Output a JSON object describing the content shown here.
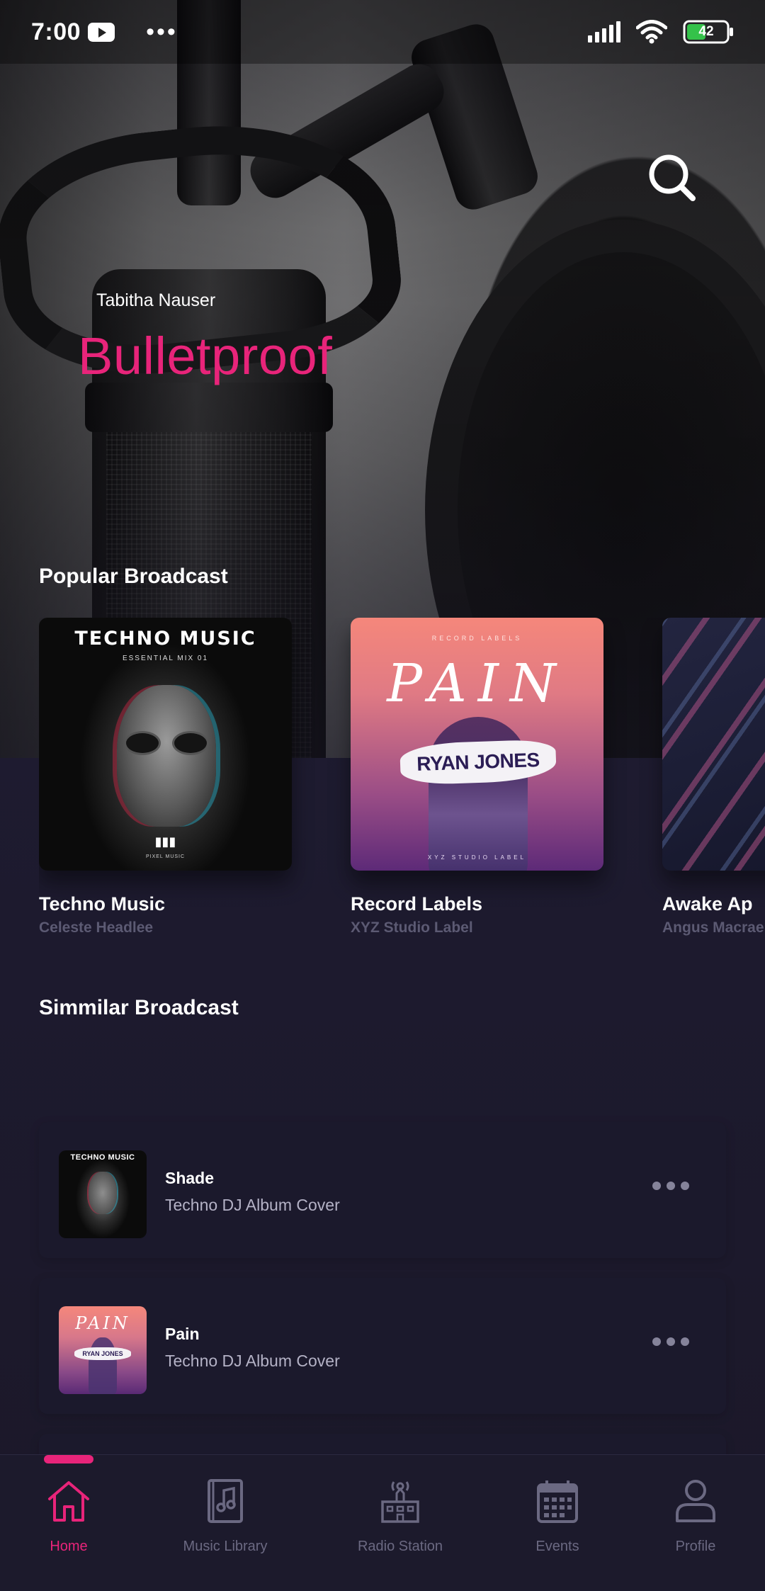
{
  "status_bar": {
    "time": "7:00",
    "more": "•••",
    "battery": "42"
  },
  "hero": {
    "artist": "Tabitha Nauser",
    "title": "Bulletproof",
    "accent_color": "#e8247a"
  },
  "popular": {
    "heading": "Popular Broadcast",
    "cards": [
      {
        "title": "Techno Music",
        "subtitle": "Celeste Headlee",
        "cover": {
          "title": "TECHNO MUSIC",
          "subtitle": "ESSENTIAL MIX 01",
          "logo": "PIXEL MUSIC"
        }
      },
      {
        "title": "Record Labels",
        "subtitle": "XYZ Studio Label",
        "cover": {
          "label": "RECORD LABELS",
          "script": "PAIN",
          "name": "RYAN JONES",
          "footer": "XYZ STUDIO LABEL"
        }
      },
      {
        "title": "Awake Ap",
        "subtitle": "Angus Macrae",
        "cover": {}
      }
    ]
  },
  "similar": {
    "heading": "Simmilar Broadcast",
    "items": [
      {
        "title": "Shade",
        "subtitle": "Techno DJ Album Cover",
        "thumb_text": "TECHNO MUSIC"
      },
      {
        "title": "Pain",
        "subtitle": "Techno DJ Album Cover",
        "thumb_text": "PAIN",
        "thumb_name": "RYAN JONES"
      }
    ]
  },
  "nav": {
    "items": [
      {
        "label": "Home",
        "icon": "home-icon",
        "active": true
      },
      {
        "label": "Music Library",
        "icon": "music-library-icon",
        "active": false
      },
      {
        "label": "Radio Station",
        "icon": "radio-station-icon",
        "active": false
      },
      {
        "label": "Events",
        "icon": "calendar-icon",
        "active": false
      },
      {
        "label": "Profile",
        "icon": "profile-icon",
        "active": false
      }
    ]
  }
}
